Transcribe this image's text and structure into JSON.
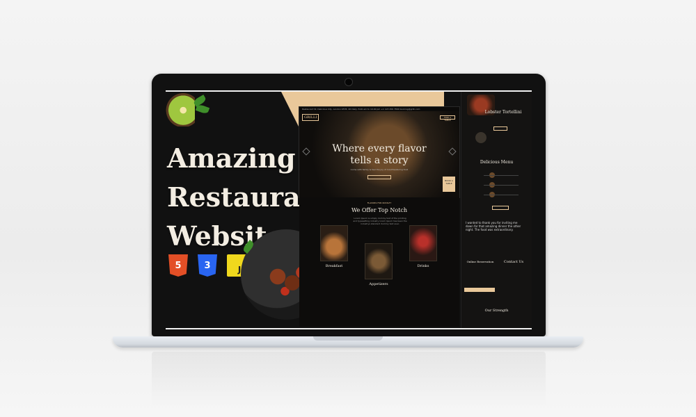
{
  "headline": {
    "line1": "Amazing",
    "line2": "Restaurant",
    "line3": "Website"
  },
  "tech_icons": [
    {
      "name": "html5-icon",
      "label": "5",
      "color": "#e34f26"
    },
    {
      "name": "css3-icon",
      "label": "3",
      "color": "#2965f1"
    },
    {
      "name": "javascript-icon",
      "label": "JS",
      "color": "#f0d81d"
    }
  ],
  "hero": {
    "topbar": "Restaurant St, Delicious City, London 9578, UK   Daily: 8.00 am to 10.00 pm   +1 123 456 7890   booking@grilli.com",
    "logo": "GRILLI",
    "title_line1": "Where every flavor",
    "title_line2": "tells a story",
    "subtitle": "Come with family & feel the joy of mouthwatering food",
    "book_label": "FIND A TABLE",
    "badge": "BOOK A TABLE"
  },
  "offer": {
    "eyebrow": "FLAVORS FOR ROYALTY",
    "title": "We Offer Top Notch",
    "text": "Lorem Ipsum is simply dummy text of the printing and typesetting industry lorem Ipsum has been the industrys standard dummy text ever.",
    "cards": [
      {
        "name": "breakfast-card",
        "label": "Breakfast"
      },
      {
        "name": "appetizers-card",
        "label": "Appetizers"
      },
      {
        "name": "drinks-card",
        "label": "Drinks"
      }
    ]
  },
  "rightcol": {
    "featured_title": "Lobster Tortellini",
    "menu_title": "Delicious Menu",
    "reservation_title": "Online Reservation",
    "contact_title": "Contact Us",
    "strength_title": "Our Strength",
    "quote": "I wanted to thank you for inviting me down for that amazing dinner the other night. The food was extraordinary."
  },
  "colors": {
    "accent": "#e9c89a",
    "dark": "#0d0c0b",
    "cream": "#f3ede2"
  }
}
